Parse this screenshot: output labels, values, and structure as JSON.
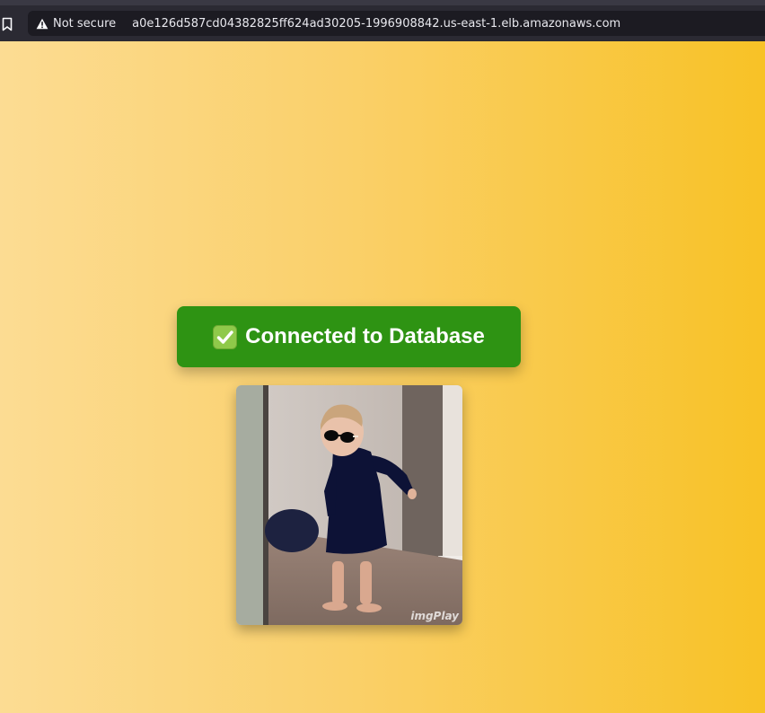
{
  "browser": {
    "security_label": "Not secure",
    "url": "a0e126d587cd04382825ff624ad30205-1996908842.us-east-1.elb.amazonaws.com",
    "icons": {
      "bookmark": "bookmark-icon",
      "security": "warning-icon"
    }
  },
  "page": {
    "status": {
      "icon": "check-mark-button-icon",
      "text": "Connected to Database",
      "color": "#2e9313"
    },
    "gif": {
      "description": "dancing-toddler-sunglasses",
      "watermark": "imgPlay"
    },
    "background_colors": [
      "#fcdc93",
      "#f8c226"
    ]
  }
}
